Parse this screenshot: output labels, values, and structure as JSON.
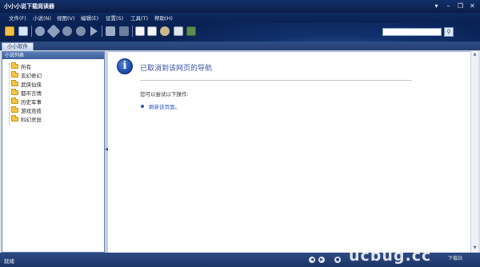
{
  "window": {
    "title": "小小小说下载阅读器"
  },
  "window_controls": [
    "▾",
    "–",
    "❐",
    "✕"
  ],
  "menu": [
    "文件(F)",
    "小说(N)",
    "视图(V)",
    "编辑(E)",
    "设置(S)",
    "工具(T)",
    "帮助(H)"
  ],
  "search": {
    "placeholder": "",
    "button_icon": "search-icon"
  },
  "tabs": [
    "小小软件"
  ],
  "sidebar": {
    "header": "小说列表",
    "items": [
      "所有",
      "玄幻奇幻",
      "武侠仙侠",
      "都市言情",
      "历史军事",
      "游戏竞技",
      "科幻灵异"
    ]
  },
  "content": {
    "heading": "已取消到该网页的导航",
    "hint": "您可以尝试以下操作:",
    "link": "刷新该页面。"
  },
  "statusbar": {
    "text": "就绪"
  },
  "watermark": {
    "main": "ucbug.cc",
    "sub": "下载站"
  },
  "colors": {
    "accent": "#2a56c0",
    "chrome": "#0e2a60"
  }
}
